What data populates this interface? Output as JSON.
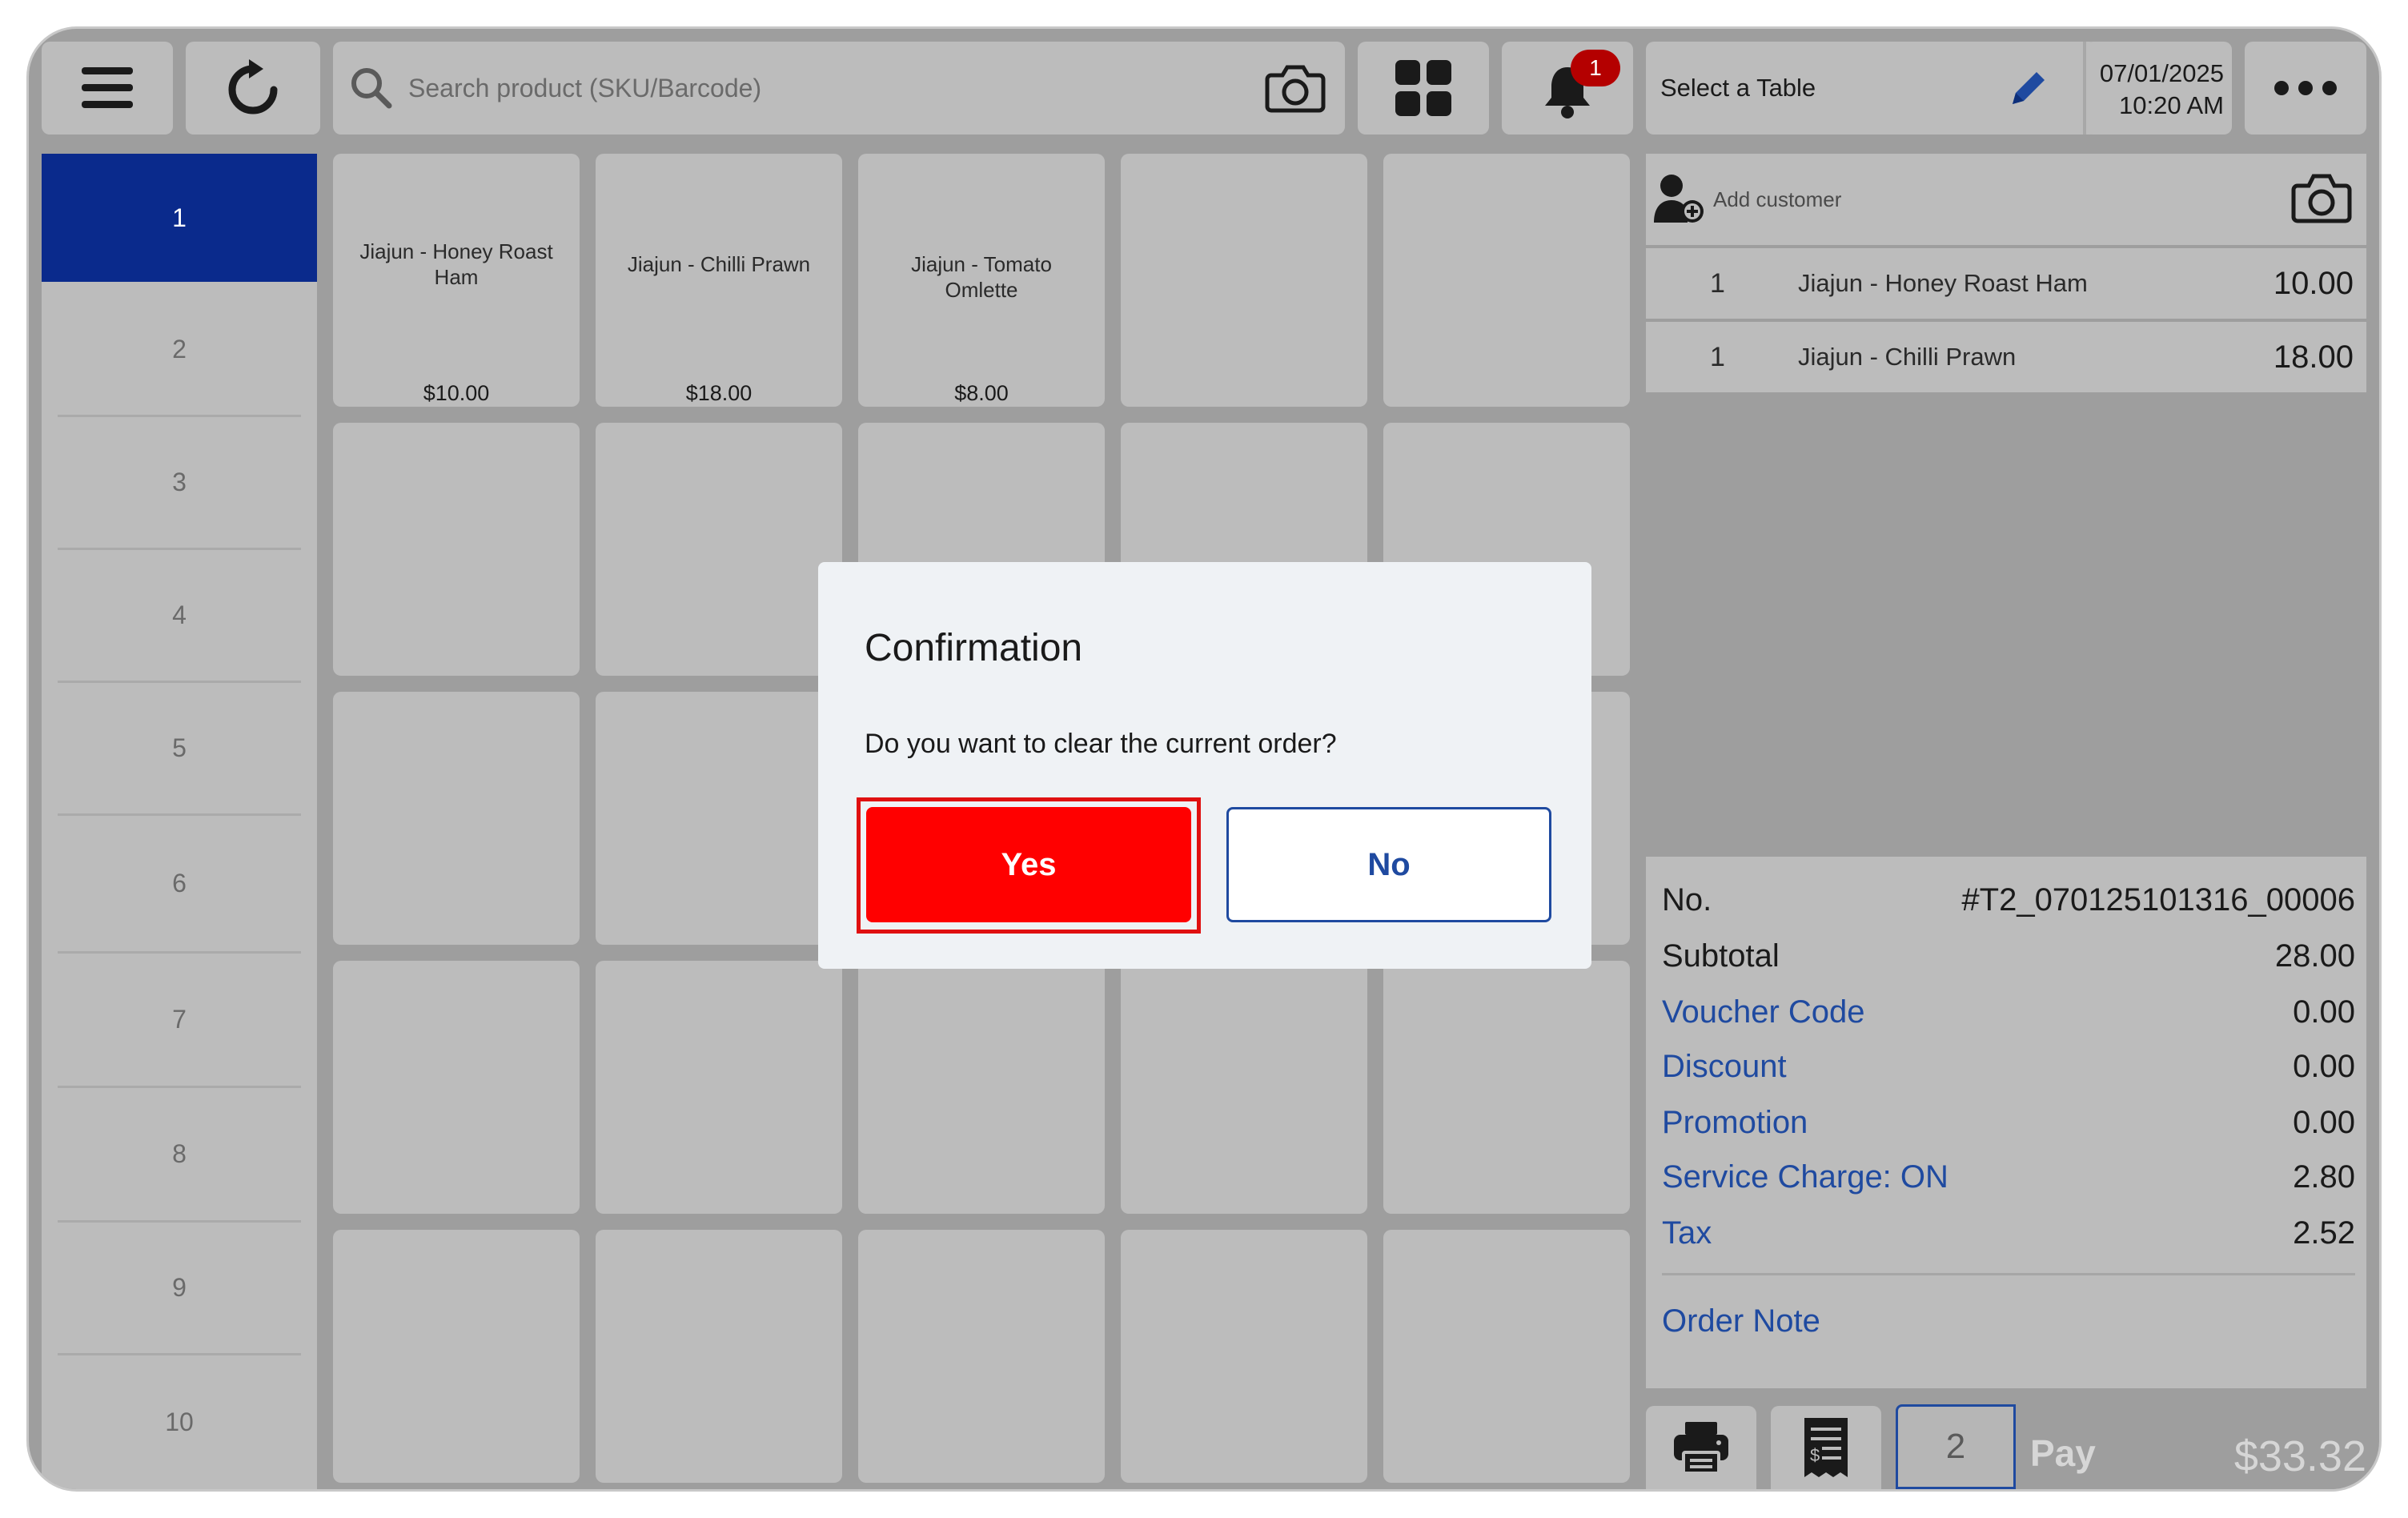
{
  "header": {
    "search_placeholder": "Search product (SKU/Barcode)",
    "notification_count": "1",
    "table_label": "Select a Table",
    "date": "07/01/2025",
    "time": "10:20 AM"
  },
  "categories": [
    "1",
    "2",
    "3",
    "4",
    "5",
    "6",
    "7",
    "8",
    "9",
    "10"
  ],
  "products": [
    {
      "name": "Jiajun - Honey Roast Ham",
      "price": "$10.00"
    },
    {
      "name": "Jiajun - Chilli Prawn",
      "price": "$18.00"
    },
    {
      "name": "Jiajun - Tomato Omlette",
      "price": "$8.00"
    }
  ],
  "order": {
    "add_customer": "Add customer",
    "lines": [
      {
        "qty": "1",
        "name": "Jiajun - Honey Roast Ham",
        "amount": "10.00"
      },
      {
        "qty": "1",
        "name": "Jiajun - Chilli Prawn",
        "amount": "18.00"
      }
    ],
    "summary": {
      "no_label": "No.",
      "no_value": "#T2_070125101316_00006",
      "subtotal_label": "Subtotal",
      "subtotal_value": "28.00",
      "voucher_label": "Voucher Code",
      "voucher_value": "0.00",
      "discount_label": "Discount",
      "discount_value": "0.00",
      "promotion_label": "Promotion",
      "promotion_value": "0.00",
      "service_label": "Service Charge: ON",
      "service_value": "2.80",
      "tax_label": "Tax",
      "tax_value": "2.52"
    },
    "note_label": "Order Note"
  },
  "footer": {
    "guest_count": "2",
    "pay_label": "Pay",
    "pay_amount": "$33.32"
  },
  "dialog": {
    "title": "Confirmation",
    "message": "Do you want to clear the current order?",
    "yes_label": "Yes",
    "no_label": "No"
  },
  "colors": {
    "accent_blue": "#0a2a8c",
    "link_blue": "#1f4aa0",
    "yes_red": "#ff0000",
    "badge_red": "#b40000"
  }
}
